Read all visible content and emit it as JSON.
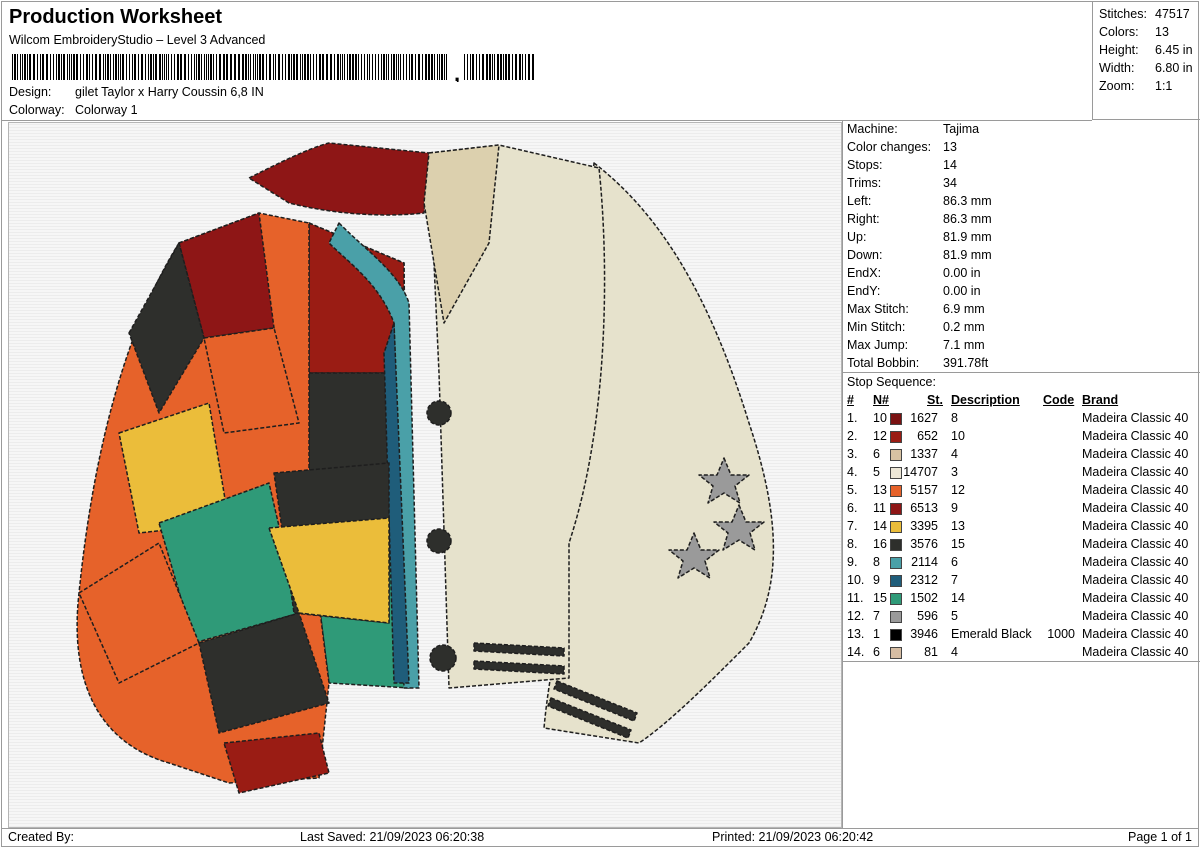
{
  "header": {
    "title": "Production Worksheet",
    "subtitle": "Wilcom EmbroideryStudio – Level 3 Advanced",
    "barcode_suffix": ",",
    "design_label": "Design:",
    "design_value": "gilet Taylor x Harry Coussin 6,8 IN",
    "colorway_label": "Colorway:",
    "colorway_value": "Colorway 1"
  },
  "summary": [
    {
      "label": "Stitches:",
      "value": "47517"
    },
    {
      "label": "Colors:",
      "value": "13"
    },
    {
      "label": "Height:",
      "value": "6.45 in"
    },
    {
      "label": "Width:",
      "value": "6.80 in"
    },
    {
      "label": "Zoom:",
      "value": "1:1"
    }
  ],
  "info": [
    {
      "label": "Machine:",
      "value": "Tajima"
    },
    {
      "label": "Color changes:",
      "value": "13"
    },
    {
      "label": "Stops:",
      "value": "14"
    },
    {
      "label": "Trims:",
      "value": "34"
    },
    {
      "label": "Left:",
      "value": "86.3 mm"
    },
    {
      "label": "Right:",
      "value": "86.3 mm"
    },
    {
      "label": "Up:",
      "value": "81.9 mm"
    },
    {
      "label": "Down:",
      "value": "81.9 mm"
    },
    {
      "label": "EndX:",
      "value": "0.00 in"
    },
    {
      "label": "EndY:",
      "value": "0.00 in"
    },
    {
      "label": "Max Stitch:",
      "value": "6.9 mm"
    },
    {
      "label": "Min Stitch:",
      "value": "0.2 mm"
    },
    {
      "label": "Max Jump:",
      "value": "7.1 mm"
    },
    {
      "label": "Total Bobbin:",
      "value": "391.78ft"
    }
  ],
  "stops": {
    "caption": "Stop Sequence:",
    "headers": {
      "num": "#",
      "n": "N#",
      "st": "St.",
      "desc": "Description",
      "code": "Code",
      "brand": "Brand"
    },
    "rows": [
      {
        "num": "1.",
        "n": "10",
        "color": "#7a1212",
        "st": "1627",
        "desc": "8",
        "code": "",
        "brand": "Madeira Classic 40"
      },
      {
        "num": "2.",
        "n": "12",
        "color": "#9a1c14",
        "st": "652",
        "desc": "10",
        "code": "",
        "brand": "Madeira Classic 40"
      },
      {
        "num": "3.",
        "n": "6",
        "color": "#d7c2a2",
        "st": "1337",
        "desc": "4",
        "code": "",
        "brand": "Madeira Classic 40"
      },
      {
        "num": "4.",
        "n": "5",
        "color": "#ece6d6",
        "st": "14707",
        "desc": "3",
        "code": "",
        "brand": "Madeira Classic 40"
      },
      {
        "num": "5.",
        "n": "13",
        "color": "#e6622a",
        "st": "5157",
        "desc": "12",
        "code": "",
        "brand": "Madeira Classic 40"
      },
      {
        "num": "6.",
        "n": "11",
        "color": "#8e1616",
        "st": "6513",
        "desc": "9",
        "code": "",
        "brand": "Madeira Classic 40"
      },
      {
        "num": "7.",
        "n": "14",
        "color": "#ebbd3a",
        "st": "3395",
        "desc": "13",
        "code": "",
        "brand": "Madeira Classic 40"
      },
      {
        "num": "8.",
        "n": "16",
        "color": "#2e2f2c",
        "st": "3576",
        "desc": "15",
        "code": "",
        "brand": "Madeira Classic 40"
      },
      {
        "num": "9.",
        "n": "8",
        "color": "#4aa0a8",
        "st": "2114",
        "desc": "6",
        "code": "",
        "brand": "Madeira Classic 40"
      },
      {
        "num": "10.",
        "n": "9",
        "color": "#1f5d7a",
        "st": "2312",
        "desc": "7",
        "code": "",
        "brand": "Madeira Classic 40"
      },
      {
        "num": "11.",
        "n": "15",
        "color": "#2f9a78",
        "st": "1502",
        "desc": "14",
        "code": "",
        "brand": "Madeira Classic 40"
      },
      {
        "num": "12.",
        "n": "7",
        "color": "#9a9a9a",
        "st": "596",
        "desc": "5",
        "code": "",
        "brand": "Madeira Classic 40"
      },
      {
        "num": "13.",
        "n": "1",
        "color": "#000000",
        "st": "3946",
        "desc": "Emerald Black",
        "code": "1000",
        "brand": "Madeira Classic 40"
      },
      {
        "num": "14.",
        "n": "6",
        "color": "#d6bda3",
        "st": "81",
        "desc": "4",
        "code": "",
        "brand": "Madeira Classic 40"
      }
    ]
  },
  "footer": {
    "created": "Created By:",
    "saved": "Last Saved: 21/09/2023 06:20:38",
    "printed": "Printed: 21/09/2023 06:20:42",
    "page": "Page 1 of 1"
  }
}
